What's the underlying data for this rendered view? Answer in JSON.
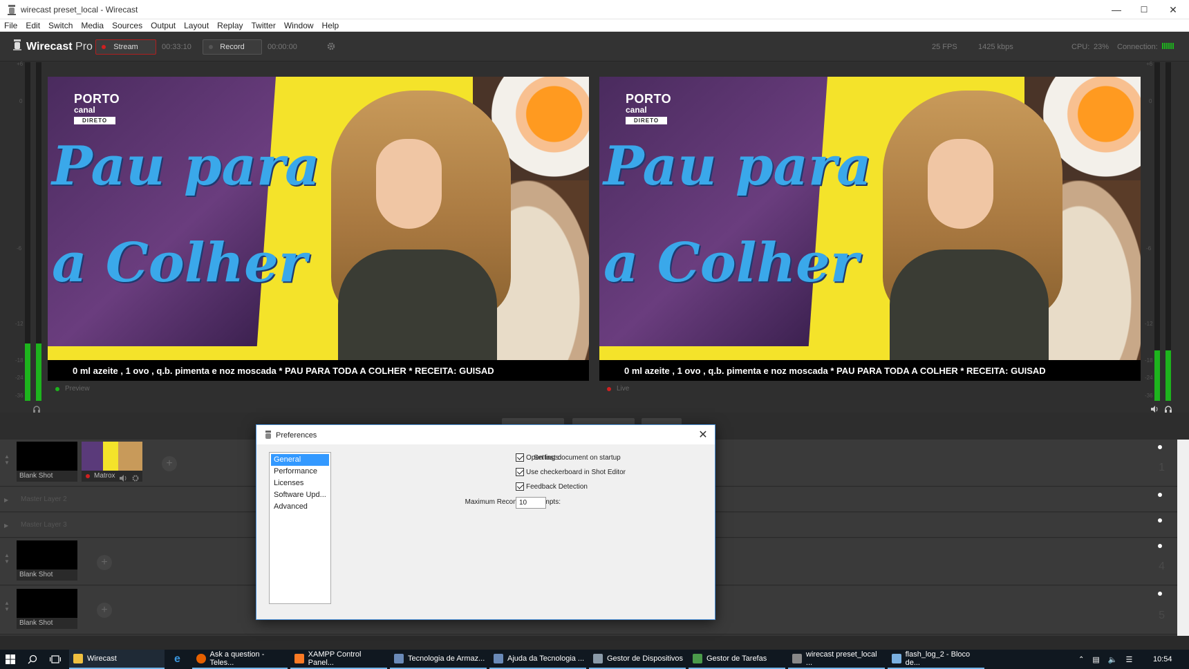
{
  "window": {
    "title": "wirecast preset_local - Wirecast",
    "minimize": "—",
    "maximize": "☐",
    "close": "✕"
  },
  "menu": [
    "File",
    "Edit",
    "Switch",
    "Media",
    "Sources",
    "Output",
    "Layout",
    "Replay",
    "Twitter",
    "Window",
    "Help"
  ],
  "toolbar": {
    "brand": "Wirecast",
    "brand_suffix": "Pro",
    "stream_label": "Stream",
    "stream_time": "00:33:10",
    "record_label": "Record",
    "record_time": "00:00:00",
    "fps": "25 FPS",
    "bitrate": "1425 kbps",
    "cpu_label": "CPU:",
    "cpu_value": "23%",
    "connection_label": "Connection:"
  },
  "scene": {
    "channel_name": "PORTO",
    "channel_sub": "canal",
    "channel_badge": "DIRETO",
    "show_title_line1": "Pau para",
    "show_title_line2": "a Colher",
    "ticker": "0 ml azeite , 1 ovo , q.b. pimenta e noz moscada     *   PAU PARA TODA A COLHER   *   RECEITA: GUISAD"
  },
  "monitors": {
    "preview_label": "Preview",
    "live_label": "Live"
  },
  "meters": {
    "scale": [
      "+6",
      "0",
      "-6",
      "-12",
      "-18",
      "-24",
      "-36"
    ],
    "left_level": 0.17,
    "right_level": 0.15
  },
  "layers": [
    {
      "name": "",
      "shots": [
        {
          "label": "Blank Shot"
        },
        {
          "label": "Matrox"
        }
      ],
      "number": "1"
    },
    {
      "name": "Master Layer 2",
      "shots": [],
      "number": "2"
    },
    {
      "name": "Master Layer 3",
      "shots": [],
      "number": "3"
    },
    {
      "name": "",
      "shots": [
        {
          "label": "Blank Shot"
        }
      ],
      "number": "4"
    },
    {
      "name": "",
      "shots": [
        {
          "label": "Blank Shot"
        }
      ],
      "number": "5"
    }
  ],
  "preferences": {
    "title": "Preferences",
    "close": "✕",
    "categories": [
      "General",
      "Performance",
      "Licenses",
      "Software Upd...",
      "Advanced"
    ],
    "selected_category": "General",
    "settings_label": "Settings:",
    "options": [
      {
        "label": "Open last document on startup",
        "checked": true
      },
      {
        "label": "Use checkerboard in Shot Editor",
        "checked": true
      },
      {
        "label": "Feedback Detection",
        "checked": true
      }
    ],
    "reconnect_label": "Maximum Reconnect Attempts:",
    "reconnect_value": "10"
  },
  "taskbar": {
    "items": [
      "Wirecast",
      "Ask a question - Teles...",
      "XAMPP Control Panel...",
      "Tecnologia de Armaz...",
      "Ajuda da Tecnologia ...",
      "Gestor de Dispositivos",
      "Gestor de Tarefas",
      "wirecast preset_local ...",
      "flash_log_2 - Bloco de..."
    ],
    "clock": "10:54"
  },
  "colors": {
    "accent_red": "#d02020",
    "meter_green": "#1db41d",
    "selection_blue": "#3399ff",
    "taskbar": "#101820"
  }
}
